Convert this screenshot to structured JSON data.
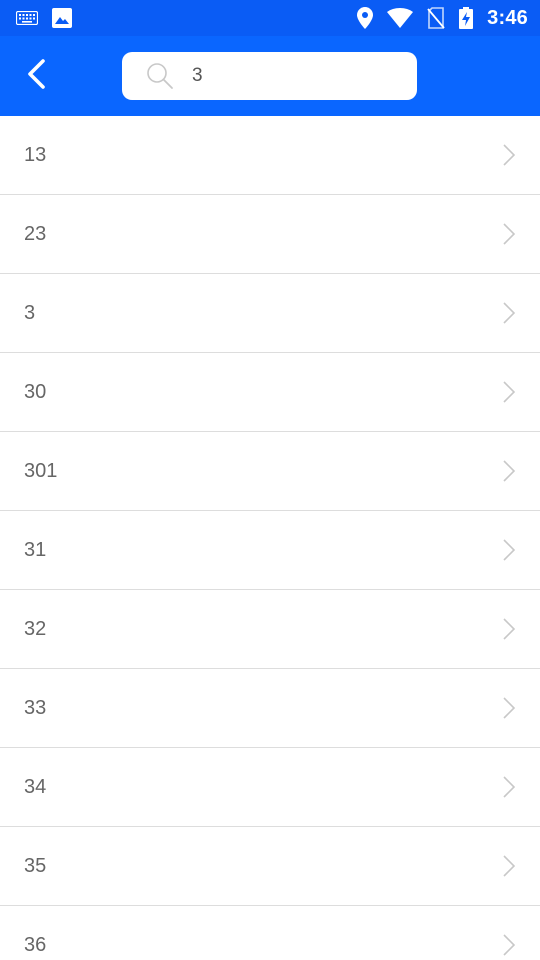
{
  "status_bar": {
    "time": "3:46",
    "icons": [
      "keyboard-icon",
      "image-icon",
      "location-icon",
      "wifi-icon",
      "no-sim-icon",
      "battery-charging-icon"
    ]
  },
  "toolbar": {
    "back_icon": "chevron-left-icon",
    "search": {
      "value": "3",
      "icon": "search-icon"
    }
  },
  "results": [
    {
      "label": "13"
    },
    {
      "label": "23"
    },
    {
      "label": "3"
    },
    {
      "label": "30"
    },
    {
      "label": "301"
    },
    {
      "label": "31"
    },
    {
      "label": "32"
    },
    {
      "label": "33"
    },
    {
      "label": "34"
    },
    {
      "label": "35"
    },
    {
      "label": "36"
    }
  ],
  "colors": {
    "status_bar": "#0a5cf5",
    "toolbar": "#0a66ff",
    "divider": "#dddddd",
    "text": "#666666",
    "chevron": "#c8c8c8"
  }
}
